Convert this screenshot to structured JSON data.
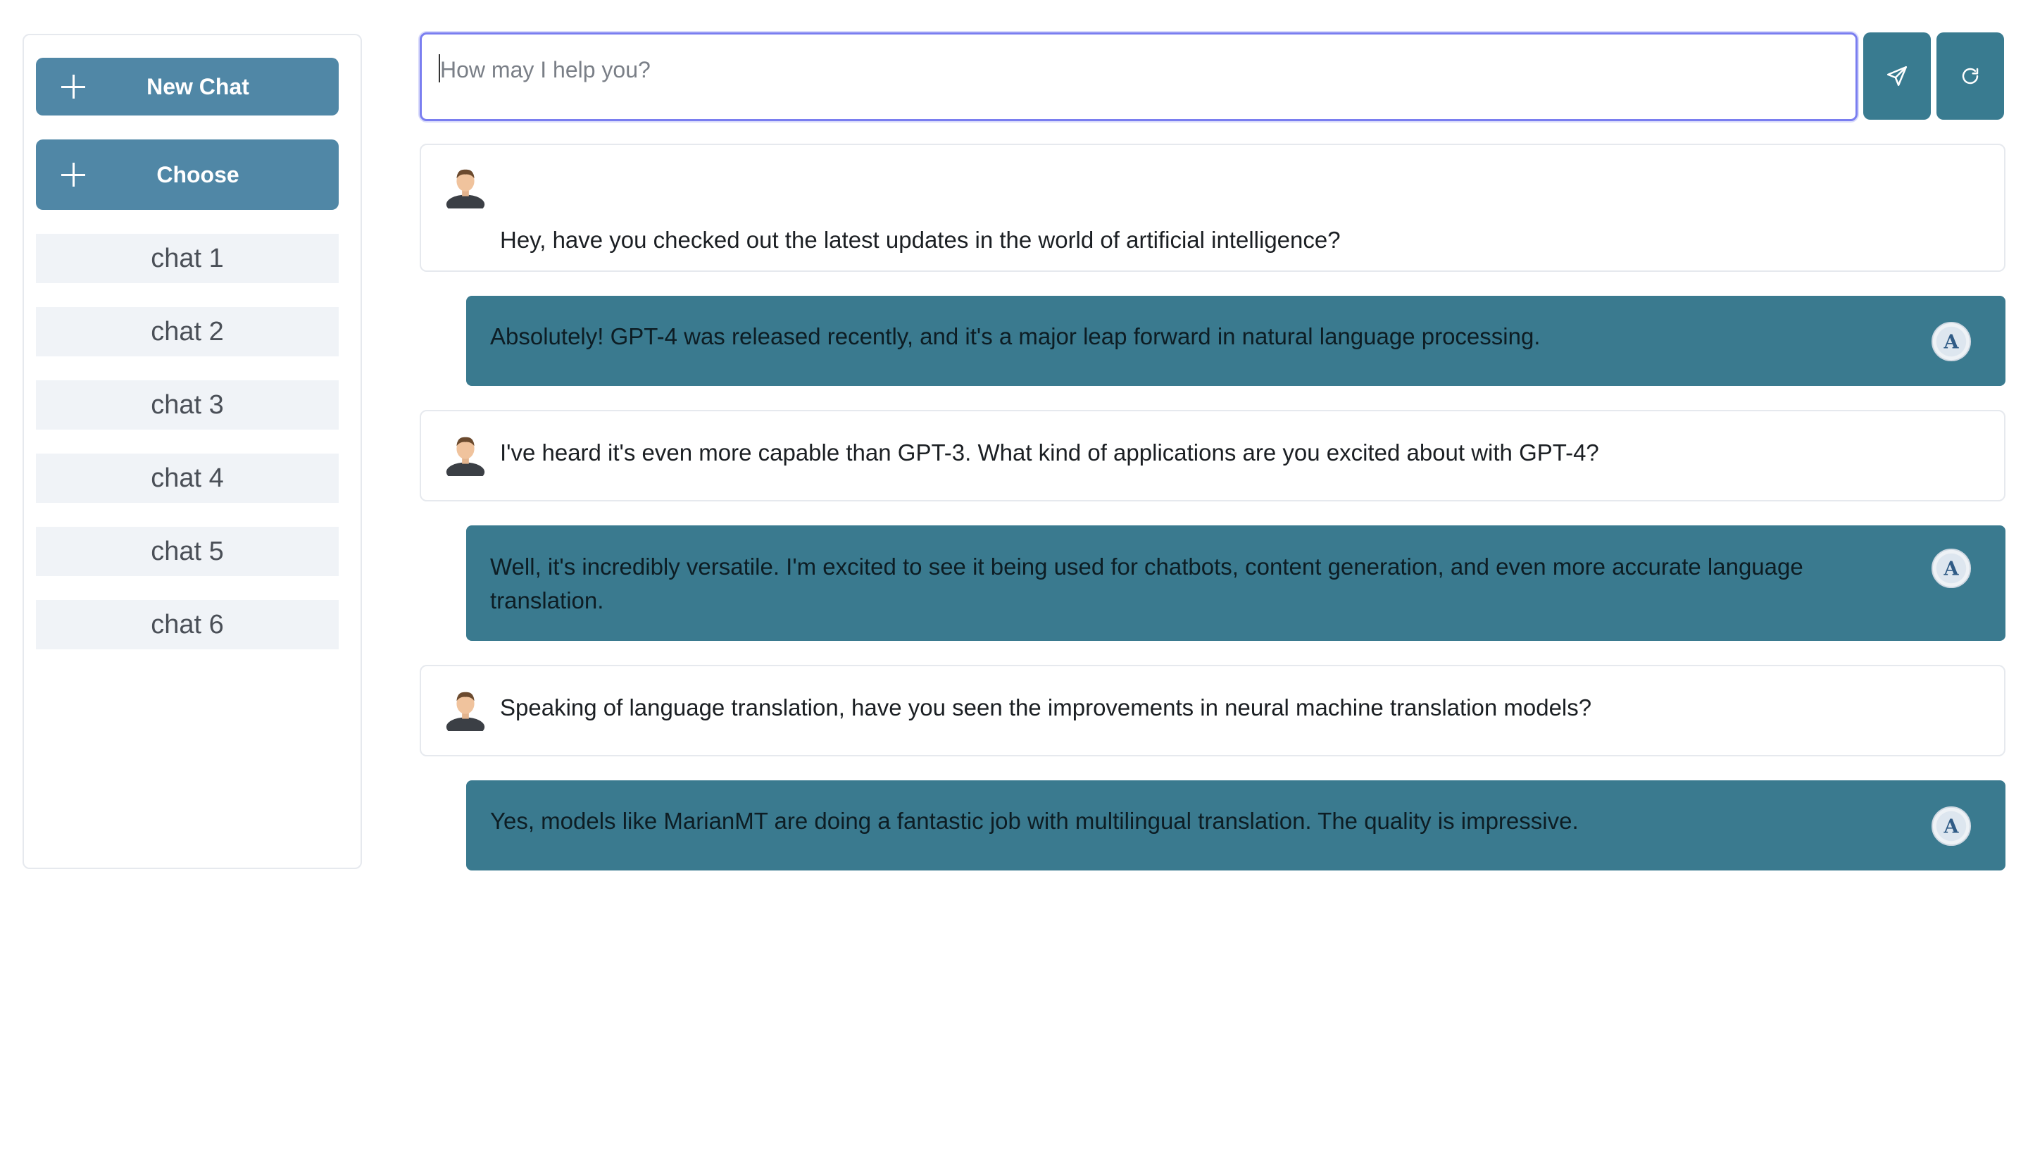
{
  "sidebar": {
    "new_chat_label": "New Chat",
    "choose_label": "Choose",
    "chats": [
      "chat 1",
      "chat 2",
      "chat 3",
      "chat 4",
      "chat 5",
      "chat 6"
    ]
  },
  "composer": {
    "placeholder": "How may I help you?",
    "send_icon": "send-icon",
    "refresh_icon": "refresh-icon"
  },
  "messages": [
    {
      "role": "user",
      "text": "Hey, have you checked out the latest updates in the world of artificial intelligence?"
    },
    {
      "role": "assistant",
      "text": "Absolutely! GPT-4 was released recently, and it's a major leap forward in natural language processing."
    },
    {
      "role": "user",
      "text": "I've heard it's even more capable than GPT-3. What kind of applications are you excited about with GPT-4?"
    },
    {
      "role": "assistant",
      "text": "Well, it's incredibly versatile. I'm excited to see it being used for chatbots, content generation, and even more accurate language translation."
    },
    {
      "role": "user",
      "text": "Speaking of language translation, have you seen the improvements in neural machine translation models?"
    },
    {
      "role": "assistant",
      "text": "Yes, models like MarianMT are doing a fantastic job with multilingual translation. The quality is impressive."
    }
  ],
  "colors": {
    "sidebar_button": "#5087a6",
    "chat_item_bg": "#f0f3f7",
    "assistant_bubble": "#3a7a8f",
    "action_button": "#397b90",
    "input_focus_border": "#7a7ef0"
  }
}
